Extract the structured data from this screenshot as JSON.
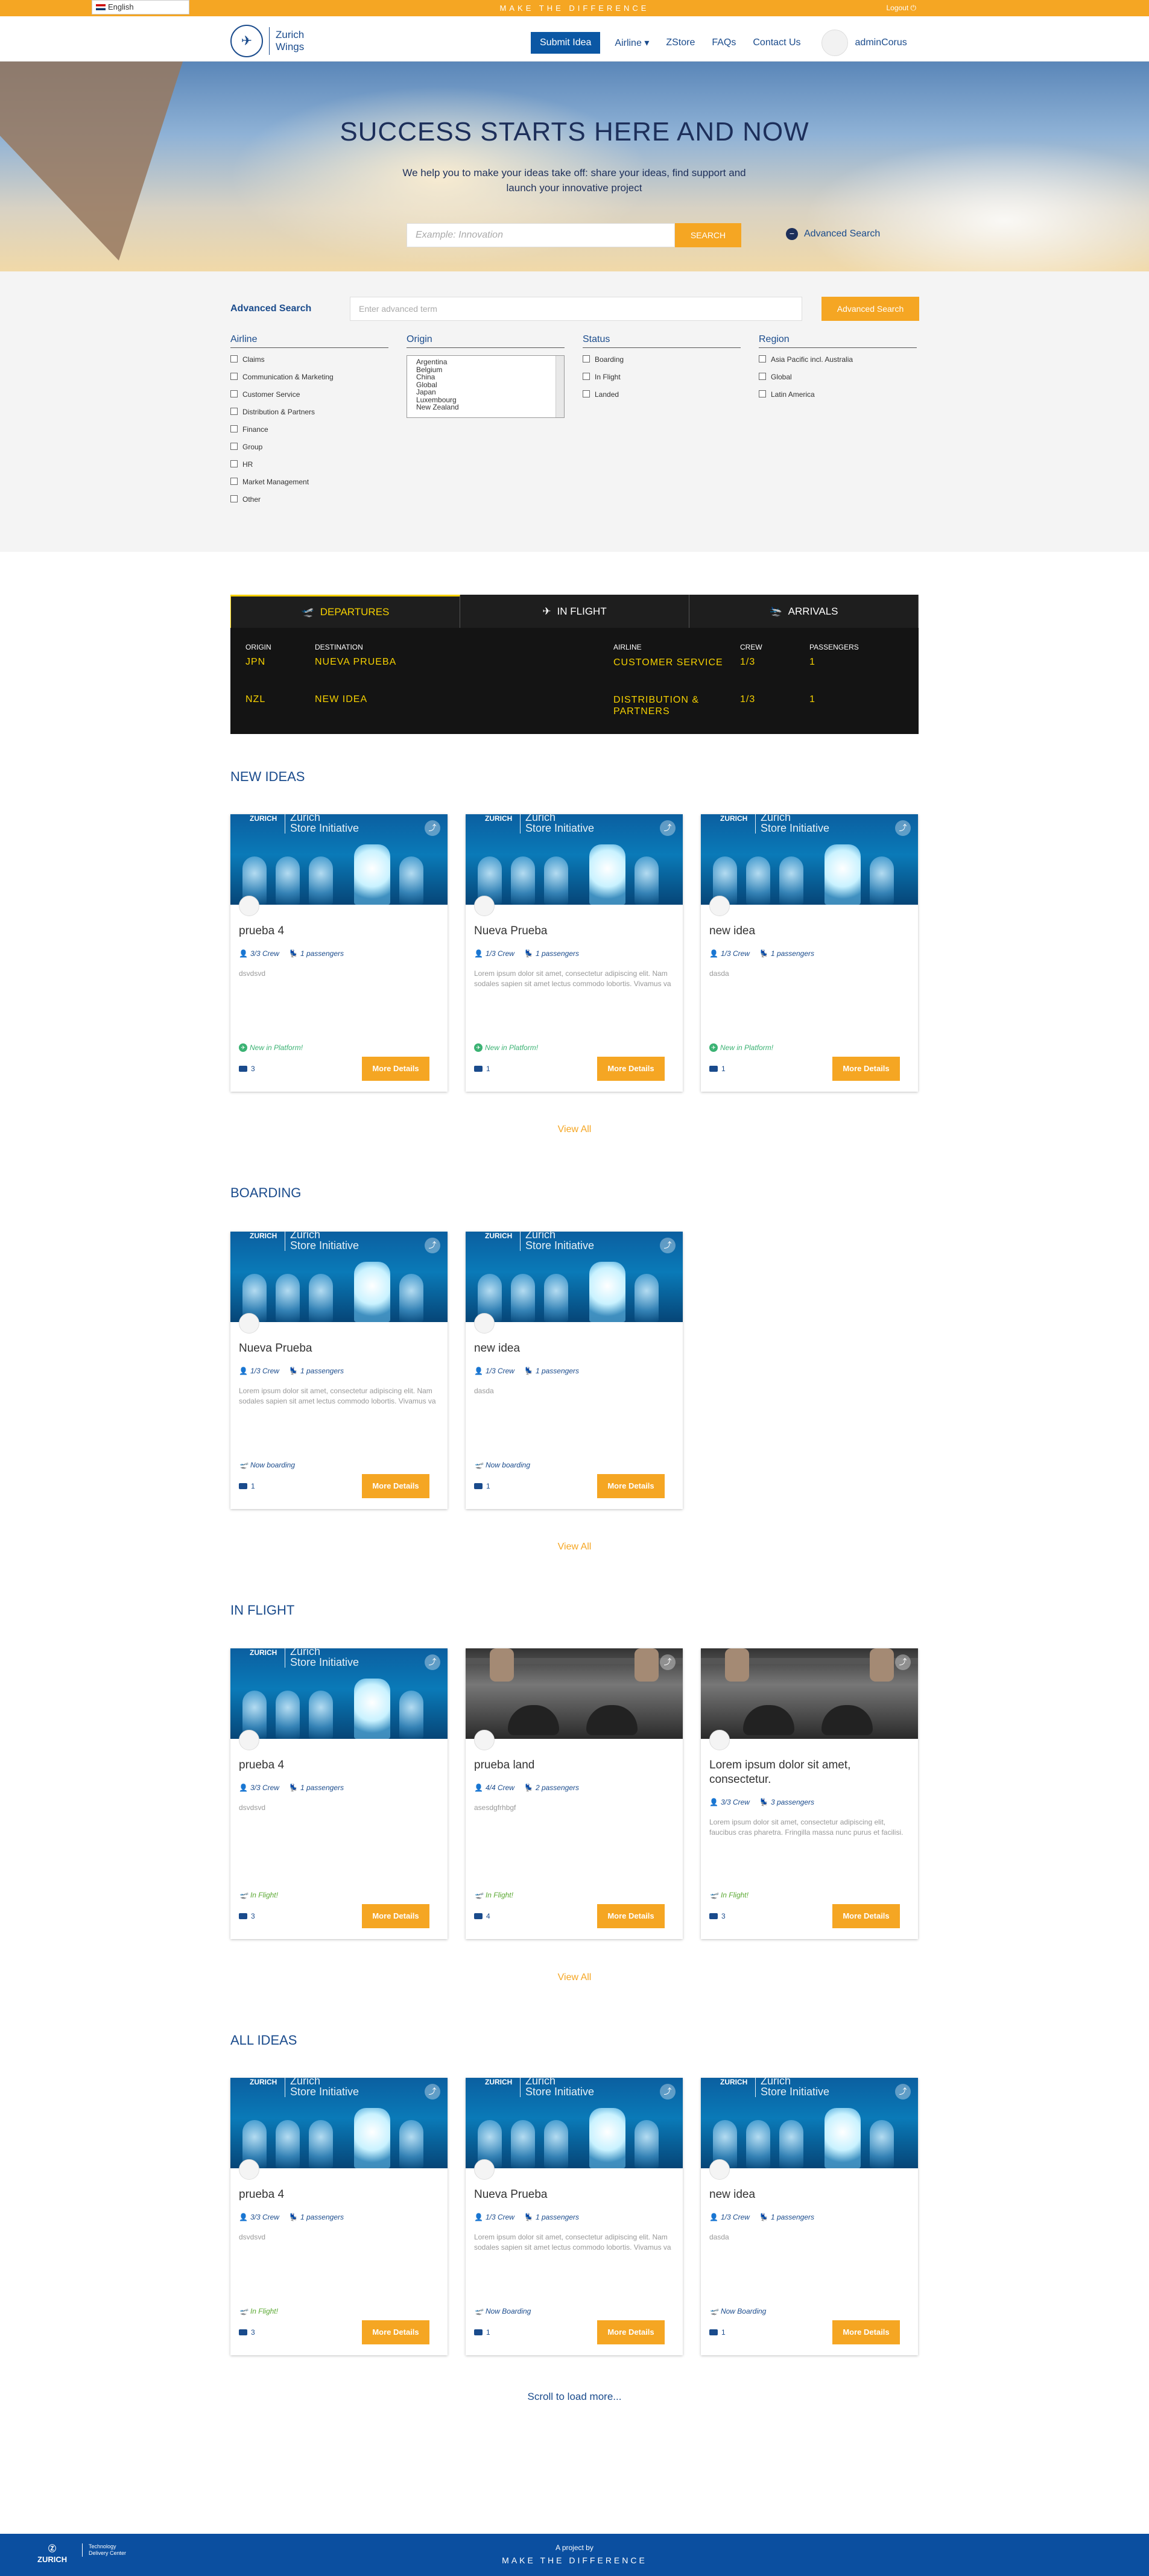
{
  "topbar": {
    "language": "English",
    "tagline": "MAKE THE DIFFERENCE",
    "logout": "Logout"
  },
  "brand": {
    "name_line1": "Zurich",
    "name_line2": "Wings"
  },
  "nav": {
    "submit": "Submit Idea",
    "airline": "Airline",
    "zstore": "ZStore",
    "faqs": "FAQs",
    "contact": "Contact Us",
    "user": "adminCorus"
  },
  "hero": {
    "title": "SUCCESS STARTS HERE AND NOW",
    "subtitle": "We help you to make your ideas take off: share your ideas, find support and launch your innovative project",
    "search_placeholder": "Example: Innovation",
    "search_button": "SEARCH",
    "advanced_link": "Advanced Search"
  },
  "advanced": {
    "label": "Advanced Search",
    "placeholder": "Enter advanced term",
    "button": "Advanced Search",
    "airline": {
      "title": "Airline",
      "options": [
        "Claims",
        "Communication & Marketing",
        "Customer Service",
        "Distribution & Partners",
        "Finance",
        "Group",
        "HR",
        "Market Management",
        "Other"
      ]
    },
    "origin": {
      "title": "Origin",
      "options": [
        "Argentina",
        "Belgium",
        "China",
        "Global",
        "Japan",
        "Luxembourg",
        "New Zealand"
      ]
    },
    "status": {
      "title": "Status",
      "options": [
        "Boarding",
        "In Flight",
        "Landed"
      ]
    },
    "region": {
      "title": "Region",
      "options": [
        "Asia Pacific incl. Australia",
        "Global",
        "Latin America"
      ]
    }
  },
  "board": {
    "tabs": [
      "DEPARTURES",
      "IN FLIGHT",
      "ARRIVALS"
    ],
    "headers": [
      "ORIGIN",
      "DESTINATION",
      "AIRLINE",
      "CREW",
      "PASSENGERS"
    ],
    "rows": [
      [
        "JPN",
        "NUEVA PRUEBA",
        "CUSTOMER SERVICE",
        "1/3",
        "1"
      ],
      [
        "NZL",
        "NEW IDEA",
        "DISTRIBUTION & PARTNERS",
        "1/3",
        "1"
      ]
    ]
  },
  "sections": {
    "new": "NEW IDEAS",
    "boarding": "BOARDING",
    "inflight": "IN FLIGHT",
    "all": "ALL IDEAS",
    "view_all": "View All",
    "load_more": "Scroll to load more...",
    "more_details": "More Details",
    "image_brand": "ZURICH",
    "image_caption_1": "Zurich",
    "image_caption_2": "Store Initiative"
  },
  "cards": {
    "new": [
      {
        "title": "prueba 4",
        "crew": "3/3 Crew",
        "passengers": "1 passengers",
        "desc": "dsvdsvd",
        "status": "New in Platform!",
        "comments": "3"
      },
      {
        "title": "Nueva Prueba",
        "crew": "1/3 Crew",
        "passengers": "1 passengers",
        "desc": "Lorem ipsum dolor sit amet, consectetur adipiscing elit. Nam sodales sapien sit amet lectus commodo lobortis. Vivamus va",
        "status": "New in Platform!",
        "comments": "1"
      },
      {
        "title": "new idea",
        "crew": "1/3 Crew",
        "passengers": "1 passengers",
        "desc": "dasda",
        "status": "New in Platform!",
        "comments": "1"
      }
    ],
    "boarding": [
      {
        "title": "Nueva Prueba",
        "crew": "1/3 Crew",
        "passengers": "1 passengers",
        "desc": "Lorem ipsum dolor sit amet, consectetur adipiscing elit. Nam sodales sapien sit amet lectus commodo lobortis. Vivamus va",
        "status": "Now boarding",
        "comments": "1"
      },
      {
        "title": "new idea",
        "crew": "1/3 Crew",
        "passengers": "1 passengers",
        "desc": "dasda",
        "status": "Now boarding",
        "comments": "1"
      }
    ],
    "inflight": [
      {
        "title": "prueba 4",
        "crew": "3/3 Crew",
        "passengers": "1 passengers",
        "desc": "dsvdsvd",
        "status": "In Flight!",
        "comments": "3"
      },
      {
        "title": "prueba land",
        "crew": "4/4 Crew",
        "passengers": "2 passengers",
        "desc": "asesdgfrhbgf",
        "status": "In Flight!",
        "comments": "4"
      },
      {
        "title": "Lorem ipsum dolor sit amet, consectetur.",
        "crew": "3/3 Crew",
        "passengers": "3 passengers",
        "desc": "Lorem ipsum dolor sit amet, consectetur adipiscing elit, faucibus cras pharetra. Fringilla massa nunc purus et facilisi.",
        "status": "In Flight!",
        "comments": "3"
      }
    ],
    "all": [
      {
        "title": "prueba 4",
        "crew": "3/3 Crew",
        "passengers": "1 passengers",
        "desc": "dsvdsvd",
        "status": "In Flight!",
        "comments": "3"
      },
      {
        "title": "Nueva Prueba",
        "crew": "1/3 Crew",
        "passengers": "1 passengers",
        "desc": "Lorem ipsum dolor sit amet, consectetur adipiscing elit. Nam sodales sapien sit amet lectus commodo lobortis. Vivamus va",
        "status": "Now Boarding",
        "comments": "1"
      },
      {
        "title": "new idea",
        "crew": "1/3 Crew",
        "passengers": "1 passengers",
        "desc": "dasda",
        "status": "Now Boarding",
        "comments": "1"
      }
    ]
  },
  "footer": {
    "logo": "ZURICH",
    "tdc_line1": "Technology",
    "tdc_line2": "Delivery Center",
    "project": "A project by",
    "make": "MAKE THE DIFFERENCE"
  },
  "colors": {
    "accent": "#f5a623",
    "brand": "#1a4b8c",
    "board_text": "#f5d000",
    "new_status": "#3bb273",
    "boarding_status": "#1a4b8c",
    "flight_status": "#5aa832"
  }
}
